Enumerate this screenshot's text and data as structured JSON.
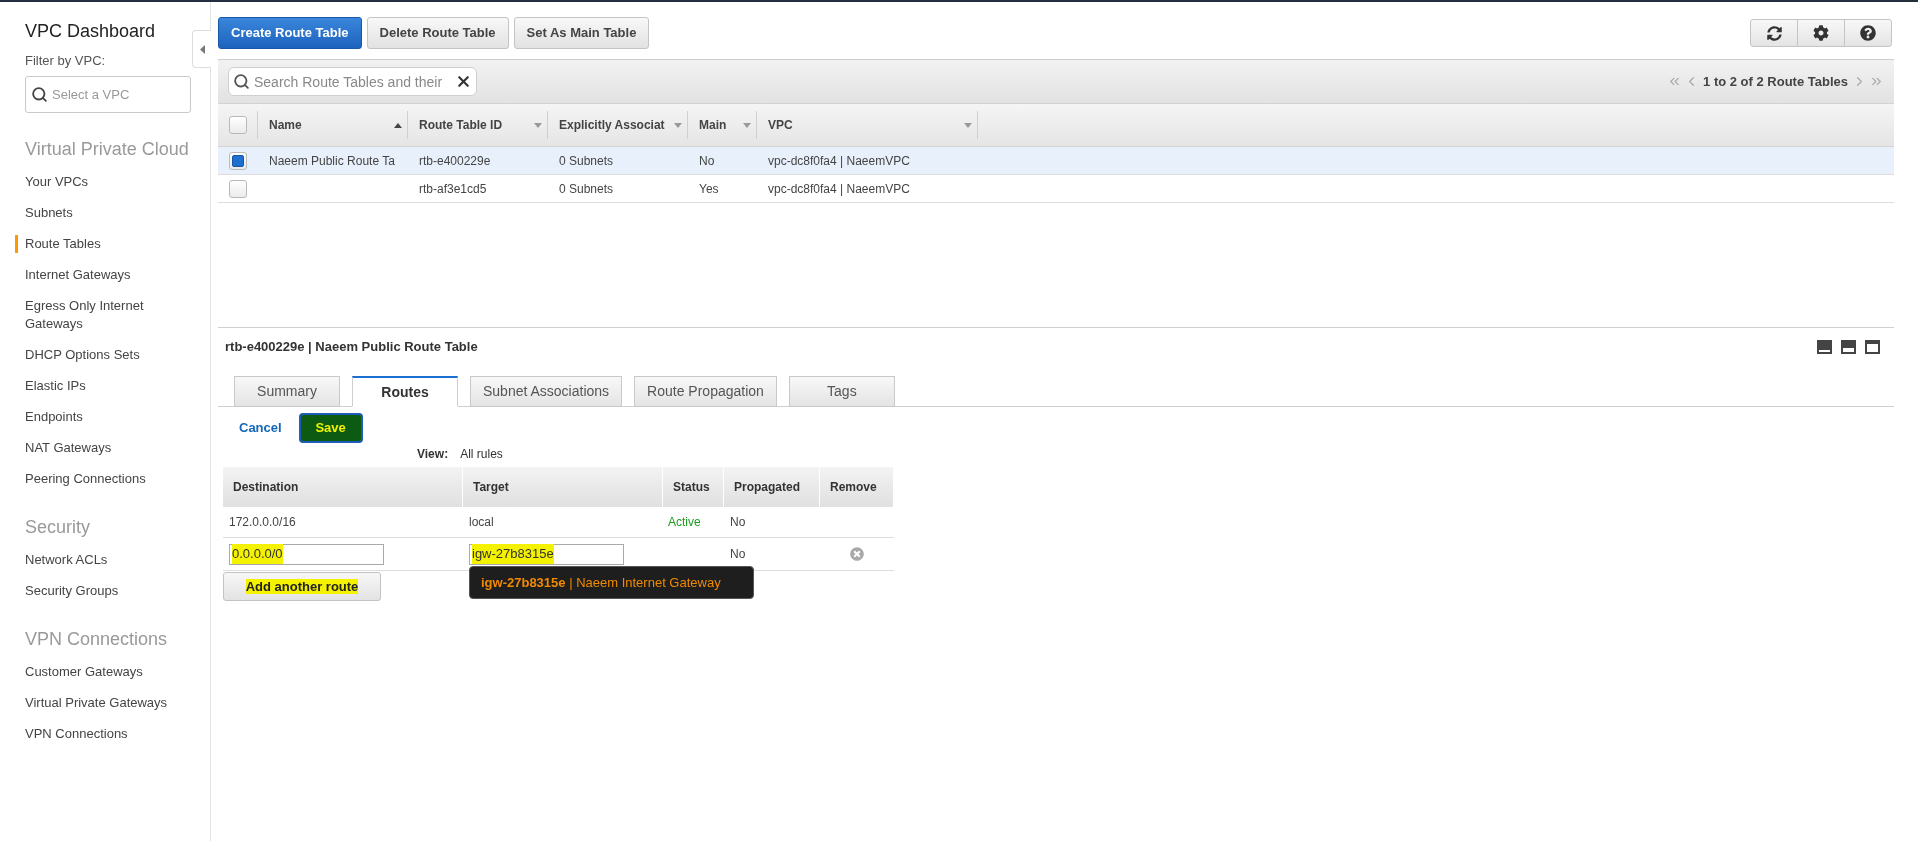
{
  "sidebar": {
    "title": "VPC Dashboard",
    "filter": {
      "label": "Filter by VPC:",
      "placeholder": "Select a VPC"
    },
    "sections": [
      {
        "heading": "Virtual Private Cloud",
        "items": [
          {
            "label": "Your VPCs",
            "selected": false
          },
          {
            "label": "Subnets",
            "selected": false
          },
          {
            "label": "Route Tables",
            "selected": true
          },
          {
            "label": "Internet Gateways",
            "selected": false
          },
          {
            "label": "Egress Only Internet Gateways",
            "selected": false
          },
          {
            "label": "DHCP Options Sets",
            "selected": false
          },
          {
            "label": "Elastic IPs",
            "selected": false
          },
          {
            "label": "Endpoints",
            "selected": false
          },
          {
            "label": "NAT Gateways",
            "selected": false
          },
          {
            "label": "Peering Connections",
            "selected": false
          }
        ]
      },
      {
        "heading": "Security",
        "items": [
          {
            "label": "Network ACLs",
            "selected": false
          },
          {
            "label": "Security Groups",
            "selected": false
          }
        ]
      },
      {
        "heading": "VPN Connections",
        "items": [
          {
            "label": "Customer Gateways",
            "selected": false
          },
          {
            "label": "Virtual Private Gateways",
            "selected": false
          },
          {
            "label": "VPN Connections",
            "selected": false
          }
        ]
      }
    ]
  },
  "toolbar": {
    "buttons": [
      {
        "label": "Create Route Table",
        "kind": "primary"
      },
      {
        "label": "Delete Route Table",
        "kind": "secondary"
      },
      {
        "label": "Set As Main Table",
        "kind": "secondary"
      }
    ]
  },
  "grid": {
    "search": {
      "placeholder": "Search Route Tables and their"
    },
    "pagination": "1 to 2 of 2 Route Tables",
    "select_all": {
      "checked": false
    },
    "columns": [
      {
        "label": "Name",
        "sorted": true
      },
      {
        "label": "Route Table ID",
        "sorted": false
      },
      {
        "label": "Explicitly Associat",
        "sorted": false
      },
      {
        "label": "Main",
        "sorted": false
      },
      {
        "label": "VPC",
        "sorted": false
      }
    ],
    "rows": [
      {
        "selected": true,
        "name": "Naeem Public Route Ta",
        "route_table_id": "rtb-e400229e",
        "explicitly_associated": "0 Subnets",
        "main": "No",
        "vpc": "vpc-dc8f0fa4 | NaeemVPC"
      },
      {
        "selected": false,
        "route_table_id": "rtb-af3e1cd5",
        "explicitly_associated": "0 Subnets",
        "main": "Yes",
        "vpc": "vpc-dc8f0fa4 | NaeemVPC"
      }
    ]
  },
  "detail": {
    "title": "rtb-e400229e | Naeem Public Route Table",
    "tabs": [
      {
        "label": "Summary",
        "selected": false
      },
      {
        "label": "Routes",
        "selected": true
      },
      {
        "label": "Subnet Associations",
        "selected": false
      },
      {
        "label": "Route Propagation",
        "selected": false
      },
      {
        "label": "Tags",
        "selected": false
      }
    ],
    "cancel": "Cancel",
    "save": {
      "label": "Save",
      "highlighted": true
    },
    "view": {
      "label": "View:",
      "value": "All rules"
    },
    "routes": {
      "columns": [
        "Destination",
        "Target",
        "Status",
        "Propagated",
        "Remove"
      ],
      "rows": [
        {
          "kind": "static",
          "destination": "172.0.0.0/16",
          "target": "local",
          "status": "Active",
          "propagated": "No"
        },
        {
          "kind": "edit",
          "destination": {
            "value": "0.0.0.0/0",
            "highlighted": true
          },
          "target": {
            "value": "igw-27b8315e",
            "highlighted": true
          },
          "propagated": "No",
          "removable": true
        }
      ]
    },
    "suggestion": "**igw-27b8315e** | Naeem Internet Gateway",
    "add_button": {
      "label": "Add another route",
      "highlighted": true
    }
  }
}
